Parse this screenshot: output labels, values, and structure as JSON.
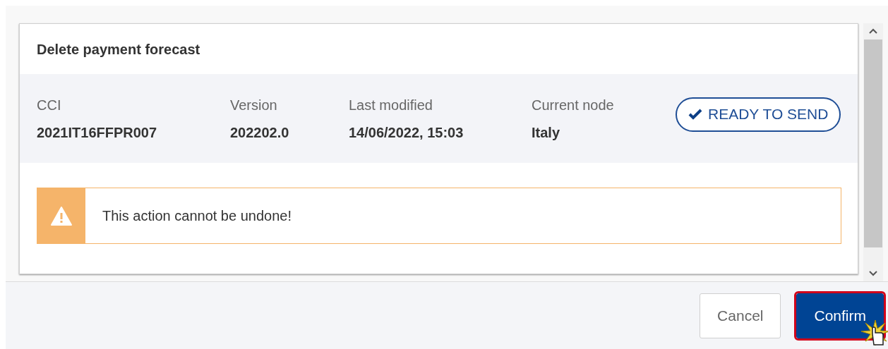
{
  "dialog": {
    "title": "Delete payment forecast",
    "fields": [
      {
        "label": "CCI",
        "value": "2021IT16FFPR007"
      },
      {
        "label": "Version",
        "value": "202202.0"
      },
      {
        "label": "Last modified",
        "value": "14/06/2022, 15:03"
      },
      {
        "label": "Current node",
        "value": "Italy"
      }
    ],
    "status_badge": "READY TO SEND",
    "warning": "This action cannot be undone!"
  },
  "buttons": [
    {
      "label": "Cancel",
      "kind": "secondary",
      "highlighted": false
    },
    {
      "label": "Confirm",
      "kind": "primary",
      "highlighted": true
    }
  ]
}
